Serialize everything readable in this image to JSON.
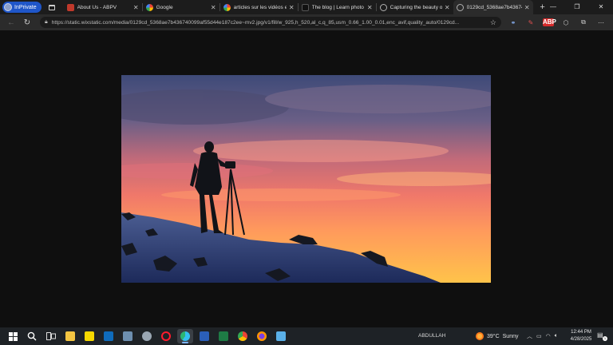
{
  "browser": {
    "inprivate_label": "InPrivate",
    "tabs": [
      {
        "title": "About Us - ABPV",
        "favicon_color": "#c0392b",
        "active": false
      },
      {
        "title": "Google",
        "favicon_color": "#4285f4",
        "active": false
      },
      {
        "title": "articles sur les vidéos et l",
        "favicon_color": "#4285f4",
        "active": false
      },
      {
        "title": "The blog | Learn photo a",
        "favicon_color": "#111111",
        "active": false
      },
      {
        "title": "Capturing the beauty of",
        "favicon_color": "#9aa0a6",
        "active": false
      },
      {
        "title": "0129cd_5368ae7b43674(",
        "favicon_color": "#9aa0a6",
        "active": true
      }
    ],
    "new_tab_label": "+",
    "window_controls": {
      "minimize": "—",
      "maximize": "❐",
      "close": "✕"
    },
    "address": {
      "url": "https://static.wixstatic.com/media/0129cd_5368ae7b436740099af55d44e187c2ee~mv2.jpg/v1/fill/w_925,h_520,al_c,q_85,usm_0.66_1.00_0.01,enc_avif,quality_auto/0129cd..."
    },
    "nav": {
      "back": "←",
      "reload": "↻"
    }
  },
  "taskbar": {
    "user_label": "ABDULLAH",
    "weather": {
      "temp": "39°C",
      "condition": "Sunny"
    },
    "clock": {
      "time": "12:44 PM",
      "date": "4/28/2025"
    },
    "notification_count": "1"
  },
  "colors": {
    "accent": "#1f56c9",
    "tab_bg": "#1c1c1c",
    "toolbar_bg": "#2b2b2b",
    "content_bg": "#0f0f0f",
    "taskbar_bg": "#1e2226"
  }
}
